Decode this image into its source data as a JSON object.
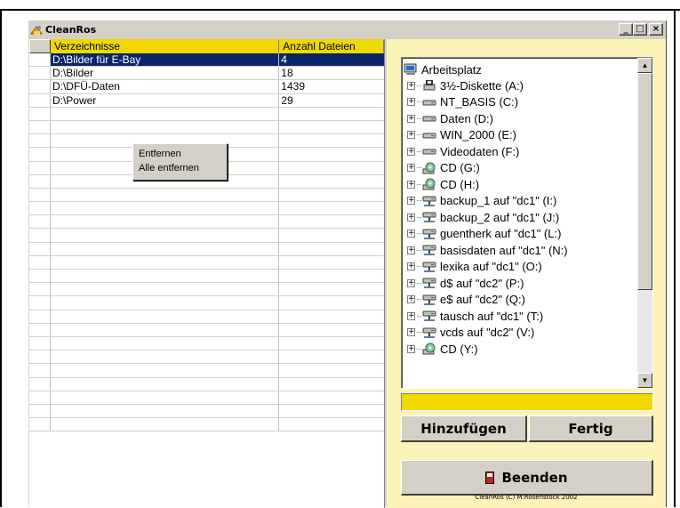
{
  "window": {
    "title": "CleanRos",
    "controls": {
      "minimize": "_",
      "maximize": "□",
      "close": "×"
    }
  },
  "list": {
    "columns": [
      "Verzeichnisse",
      "Anzahl Dateien"
    ],
    "rows": [
      {
        "path": "D:\\Bilder für E-Bay",
        "count": "4",
        "selected": true
      },
      {
        "path": "D:\\Bilder",
        "count": "18",
        "selected": false
      },
      {
        "path": "D:\\DFÜ-Daten",
        "count": "1439",
        "selected": false
      },
      {
        "path": "D:\\Power",
        "count": "29",
        "selected": false
      }
    ],
    "empty_rows": 24
  },
  "context_menu": {
    "items": [
      "Entfernen",
      "Alle entfernen"
    ]
  },
  "tree": {
    "root": "Arbeitsplatz",
    "items": [
      {
        "label": "3½-Diskette (A:)",
        "icon": "floppy-drive-icon"
      },
      {
        "label": "NT_BASIS (C:)",
        "icon": "hard-drive-icon"
      },
      {
        "label": "Daten (D:)",
        "icon": "hard-drive-icon"
      },
      {
        "label": "WIN_2000 (E:)",
        "icon": "hard-drive-icon"
      },
      {
        "label": "Videodaten (F:)",
        "icon": "hard-drive-icon"
      },
      {
        "label": "CD (G:)",
        "icon": "cd-drive-icon"
      },
      {
        "label": "CD (H:)",
        "icon": "cd-drive-icon"
      },
      {
        "label": "backup_1 auf \"dc1\" (I:)",
        "icon": "network-drive-icon"
      },
      {
        "label": "backup_2 auf \"dc1\" (J:)",
        "icon": "network-drive-icon"
      },
      {
        "label": "guentherk auf \"dc1\" (L:)",
        "icon": "network-drive-icon"
      },
      {
        "label": "basisdaten auf \"dc1\" (N:)",
        "icon": "network-drive-icon"
      },
      {
        "label": "lexika auf \"dc1\" (O:)",
        "icon": "network-drive-icon"
      },
      {
        "label": "d$ auf \"dc2\" (P:)",
        "icon": "network-drive-icon"
      },
      {
        "label": "e$ auf \"dc2\" (Q:)",
        "icon": "network-drive-icon"
      },
      {
        "label": "tausch auf \"dc1\" (T:)",
        "icon": "network-drive-icon"
      },
      {
        "label": "vcds auf \"dc2\" (V:)",
        "icon": "network-drive-icon"
      },
      {
        "label": "CD (Y:)",
        "icon": "cd-drive-icon"
      }
    ]
  },
  "path_field": {
    "value": ""
  },
  "buttons": {
    "add": "Hinzufügen",
    "done": "Fertig",
    "quit": "Beenden"
  },
  "copyright": "CleanRos (C) M.Rosenstock 2002",
  "colors": {
    "header_yellow": "#f0d800",
    "panel_yellow": "#fcf3b8",
    "selection_blue": "#0a246a"
  }
}
